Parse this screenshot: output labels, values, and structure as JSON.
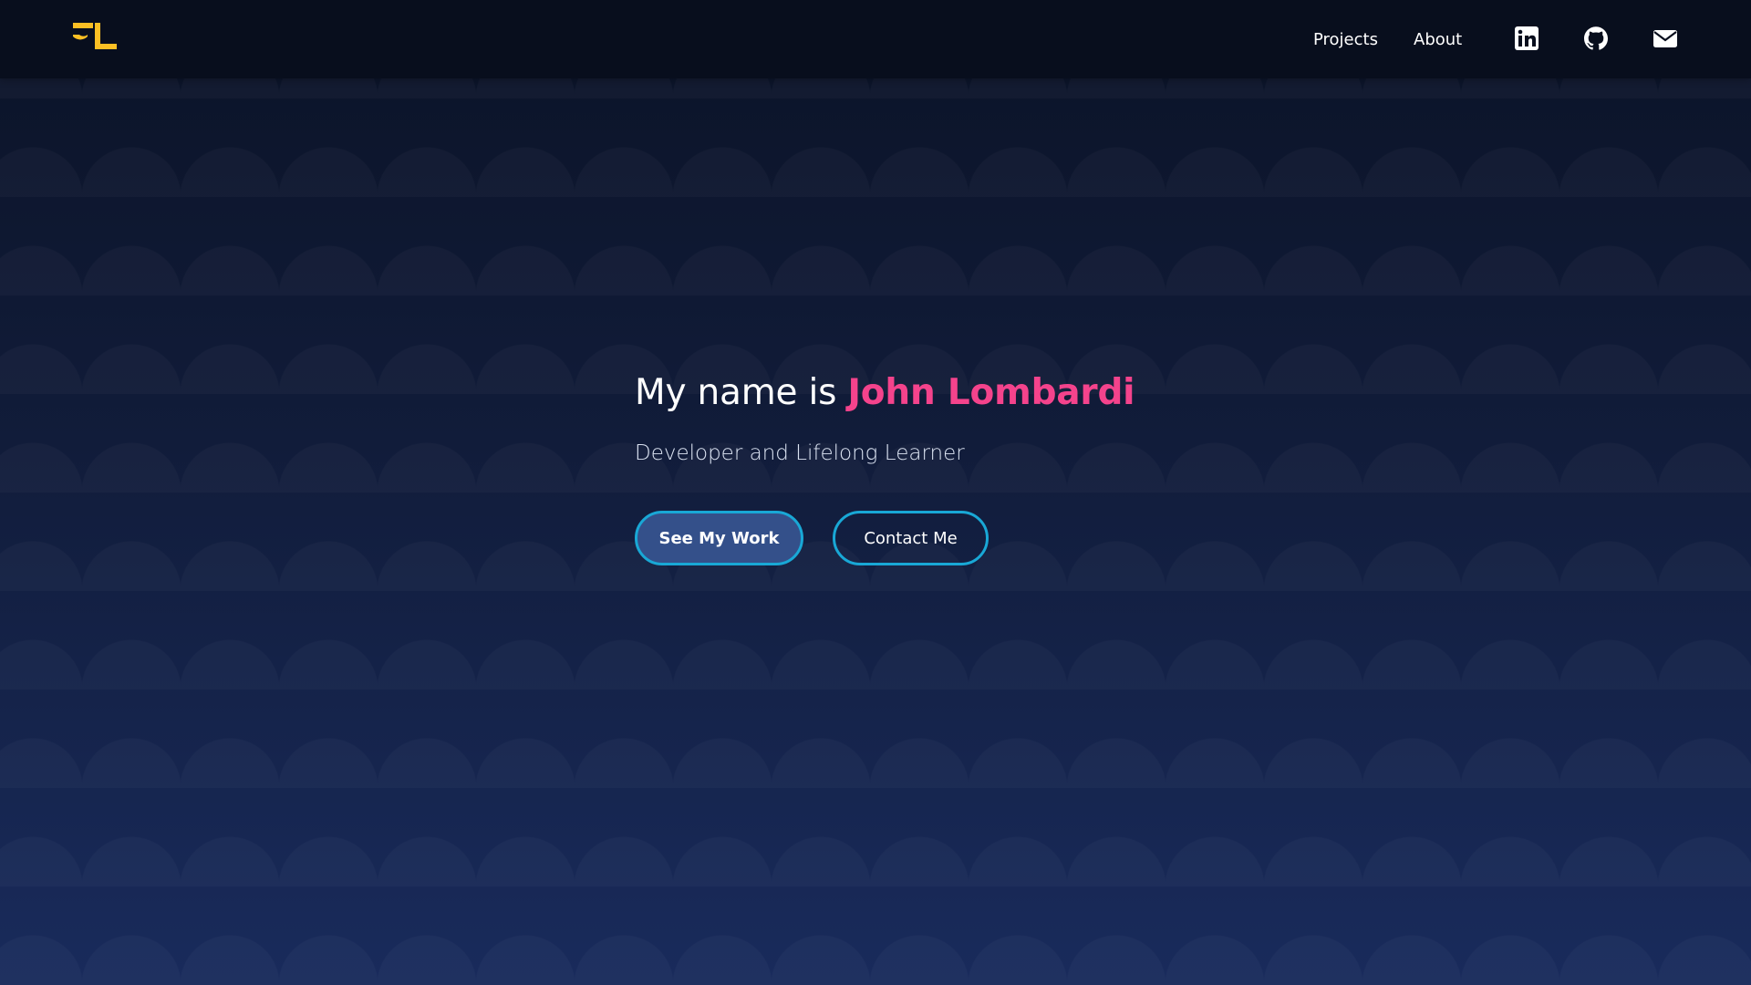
{
  "site": {
    "logo_icon": "jl-monogram-logo",
    "accent_logo": "#fbbf24",
    "accent_name": "#f4438c",
    "accent_button_border": "#19a8d6"
  },
  "nav": {
    "projects_label": "Projects",
    "about_label": "About",
    "icons": [
      "linkedin-icon",
      "github-icon",
      "mail-icon"
    ]
  },
  "hero": {
    "title_prefix": "My name is",
    "title_name": "John Lombardi",
    "subtitle": "Developer and Lifelong Learner",
    "primary_button": "See My Work",
    "secondary_button": "Contact Me"
  }
}
